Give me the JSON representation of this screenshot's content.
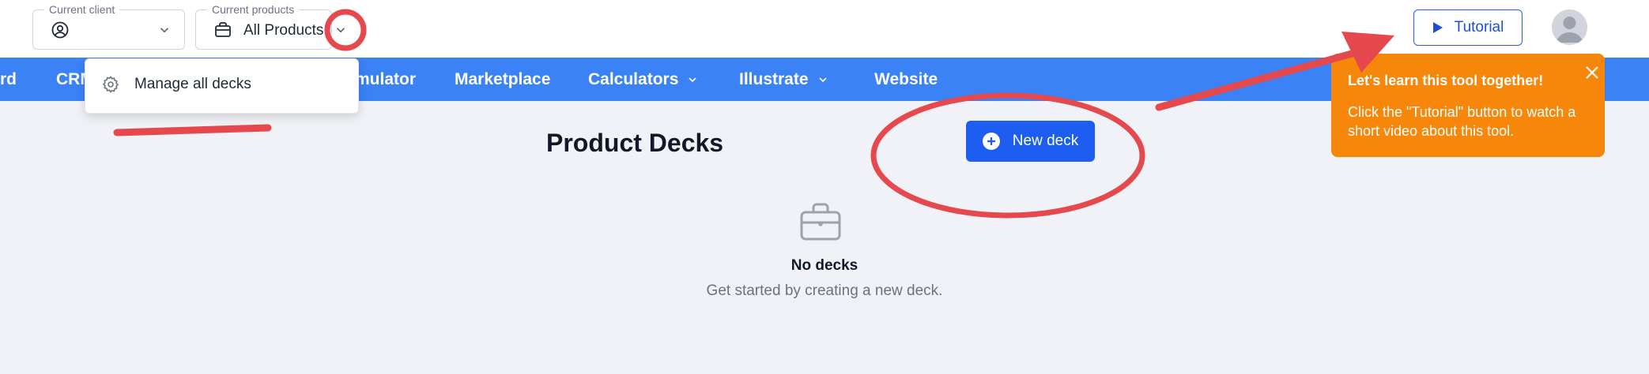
{
  "header": {
    "client_field": {
      "legend": "Current client",
      "value": "",
      "icon": "user-circle-icon"
    },
    "products_field": {
      "legend": "Current products",
      "value": "All Products",
      "icon": "briefcase-icon"
    },
    "tutorial_button": {
      "label": "Tutorial",
      "icon": "play-icon"
    },
    "avatar": {
      "icon": "user-avatar-icon"
    }
  },
  "navbar": {
    "items": [
      {
        "label": "rd"
      },
      {
        "label": "CRM"
      },
      {
        "label": "mulator"
      },
      {
        "label": "Marketplace"
      },
      {
        "label": "Calculators",
        "has_dropdown": true
      },
      {
        "label": "Illustrate",
        "has_dropdown": true
      },
      {
        "label": "Website"
      }
    ]
  },
  "products_dropdown": {
    "items": [
      {
        "label": "Manage all decks",
        "icon": "gear-icon"
      }
    ]
  },
  "main": {
    "title": "Product Decks",
    "new_deck_button": {
      "label": "New deck",
      "icon": "plus-circle-icon"
    },
    "empty_state": {
      "icon": "briefcase-icon",
      "title": "No decks",
      "subtitle": "Get started by creating a new deck."
    }
  },
  "tutorial_tooltip": {
    "title": "Let's learn this tool together!",
    "body": "Click the \"Tutorial\" button to watch a short video about this tool.",
    "icon": "close-icon"
  },
  "colors": {
    "nav_bg": "#3b82f6",
    "primary_button": "#1d5ef0",
    "tooltip_bg": "#f7870a",
    "annotation": "#e5484d",
    "page_bg": "#f0f2f7"
  }
}
